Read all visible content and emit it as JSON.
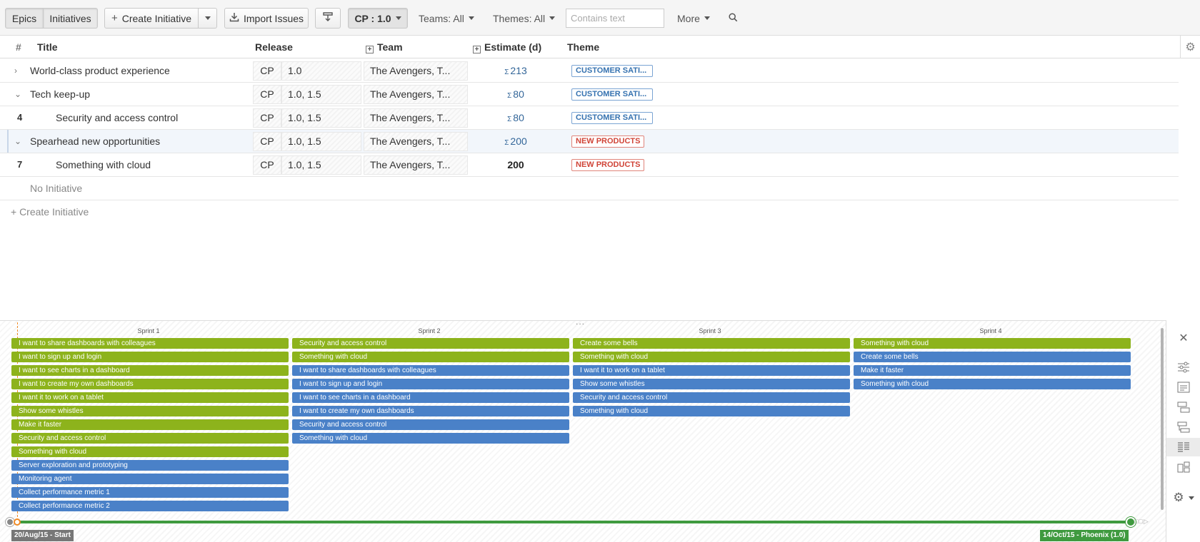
{
  "toolbar": {
    "epics": "Epics",
    "initiatives": "Initiatives",
    "create_initiative": "Create Initiative",
    "import_issues": "Import Issues",
    "release_filter": "CP : 1.0",
    "teams_filter": "Teams: All",
    "themes_filter": "Themes: All",
    "search_placeholder": "Contains text",
    "more": "More"
  },
  "table": {
    "headers": {
      "num": "#",
      "title": "Title",
      "release": "Release",
      "team": "Team",
      "estimate": "Estimate (d)",
      "theme": "Theme"
    },
    "rows": [
      {
        "num": "",
        "expander": "›",
        "title": "World-class product experience",
        "project": "CP",
        "release": "1.0",
        "team": "The Avengers, T...",
        "sigma": "Σ",
        "estimate": "213",
        "theme": "CUSTOMER SATI...",
        "theme_color": "#3572b0"
      },
      {
        "num": "",
        "expander": "⌄",
        "title": "Tech keep-up",
        "project": "CP",
        "release": "1.0, 1.5",
        "team": "The Avengers, T...",
        "sigma": "Σ",
        "estimate": "80",
        "theme": "CUSTOMER SATI...",
        "theme_color": "#3572b0"
      },
      {
        "num": "4",
        "expander": "",
        "title": "Security and access control",
        "project": "CP",
        "release": "1.0, 1.5",
        "team": "The Avengers, T...",
        "sigma": "Σ",
        "estimate": "80",
        "theme": "CUSTOMER SATI...",
        "theme_color": "#3572b0"
      },
      {
        "num": "",
        "expander": "⌄",
        "title": "Spearhead new opportunities",
        "project": "CP",
        "release": "1.0, 1.5",
        "team": "The Avengers, T...",
        "sigma": "Σ",
        "estimate": "200",
        "theme": "NEW PRODUCTS",
        "theme_color": "#d04437"
      },
      {
        "num": "7",
        "expander": "",
        "title": "Something with cloud",
        "project": "CP",
        "release": "1.0, 1.5",
        "team": "The Avengers, T...",
        "sigma": "",
        "estimate": "200",
        "theme": "NEW PRODUCTS",
        "theme_color": "#d04437"
      }
    ],
    "no_initiative": "No Initiative",
    "create_initiative_link": "+ Create Initiative"
  },
  "board": {
    "drag_handle": "...",
    "sprints": [
      {
        "title": "Sprint 1",
        "cards": [
          {
            "label": "I want to share dashboards with colleagues",
            "color": "green"
          },
          {
            "label": "I want to sign up and login",
            "color": "green"
          },
          {
            "label": "I want to see charts in a dashboard",
            "color": "green"
          },
          {
            "label": "I want to create my own dashboards",
            "color": "green"
          },
          {
            "label": "I want it to work on a tablet",
            "color": "green"
          },
          {
            "label": "Show some whistles",
            "color": "green"
          },
          {
            "label": "Make it faster",
            "color": "green"
          },
          {
            "label": "Security and access control",
            "color": "green"
          },
          {
            "label": "Something with cloud",
            "color": "green"
          },
          {
            "label": "Server exploration and prototyping",
            "color": "blue"
          },
          {
            "label": "Monitoring agent",
            "color": "blue"
          },
          {
            "label": "Collect performance metric 1",
            "color": "blue"
          },
          {
            "label": "Collect performance metric 2",
            "color": "blue"
          }
        ]
      },
      {
        "title": "Sprint 2",
        "cards": [
          {
            "label": "Security and access control",
            "color": "green"
          },
          {
            "label": "Something with cloud",
            "color": "green"
          },
          {
            "label": "I want to share dashboards with colleagues",
            "color": "blue"
          },
          {
            "label": "I want to sign up and login",
            "color": "blue"
          },
          {
            "label": "I want to see charts in a dashboard",
            "color": "blue"
          },
          {
            "label": "I want to create my own dashboards",
            "color": "blue"
          },
          {
            "label": "Security and access control",
            "color": "blue"
          },
          {
            "label": "Something with cloud",
            "color": "blue"
          }
        ]
      },
      {
        "title": "Sprint 3",
        "cards": [
          {
            "label": "Create some bells",
            "color": "green"
          },
          {
            "label": "Something with cloud",
            "color": "green"
          },
          {
            "label": "I want it to work on a tablet",
            "color": "blue"
          },
          {
            "label": "Show some whistles",
            "color": "blue"
          },
          {
            "label": "Security and access control",
            "color": "blue"
          },
          {
            "label": "Something with cloud",
            "color": "blue"
          }
        ]
      },
      {
        "title": "Sprint 4",
        "cards": [
          {
            "label": "Something with cloud",
            "color": "green"
          },
          {
            "label": "Create some bells",
            "color": "blue"
          },
          {
            "label": "Make it faster",
            "color": "blue"
          },
          {
            "label": "Something with cloud",
            "color": "blue"
          }
        ]
      }
    ],
    "timeline": {
      "start_label": "20/Aug/15 - Start",
      "end_label": "14/Oct/15 - Phoenix (1.0)",
      "tail": "□□▷"
    },
    "colors": {
      "green": "#8db31c",
      "blue": "#4a81c8",
      "timeline": "#3f9a3f",
      "start_marker": "#f08a24"
    },
    "side_icons": [
      "close-icon",
      "filter-sliders-icon",
      "card-view-icon",
      "stack-view-icon",
      "tree-view-icon",
      "list-view-icon",
      "split-view-icon",
      "gear-icon"
    ]
  }
}
